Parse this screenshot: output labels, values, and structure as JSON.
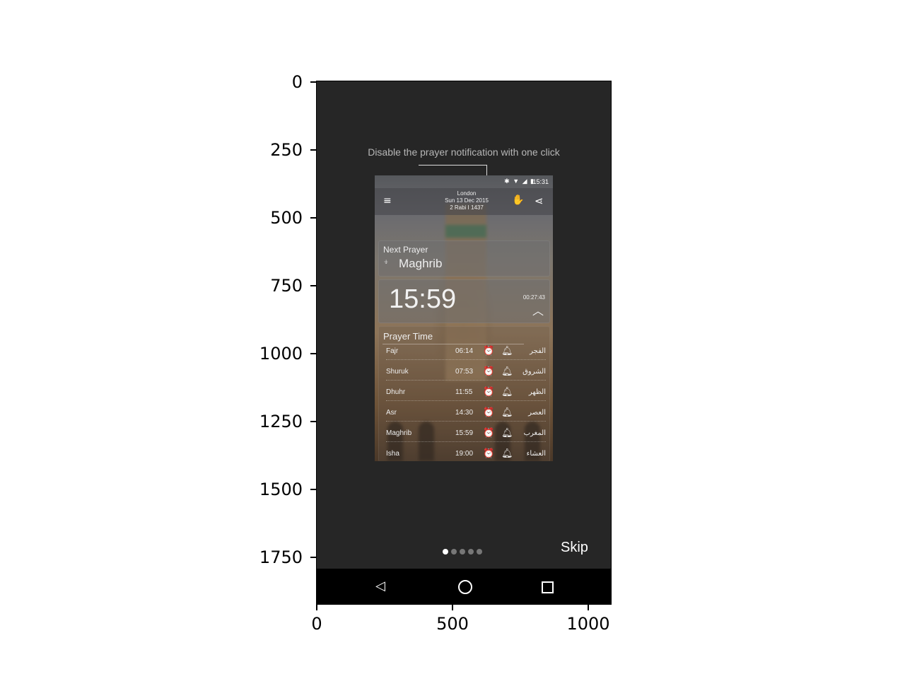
{
  "axes": {
    "y_ticks": [
      "0",
      "250",
      "500",
      "750",
      "1000",
      "1250",
      "1500",
      "1750"
    ],
    "x_ticks": [
      "0",
      "500",
      "1000"
    ]
  },
  "onboarding": {
    "hint": "Disable the prayer notification with one click",
    "skip_label": "Skip",
    "pager": {
      "count": 5,
      "active_index": 0
    }
  },
  "app": {
    "status_time": "15:31",
    "status_icons": "✱ ▼ ◢ ▮",
    "header": {
      "city": "London",
      "date": "Sun 13 Dec 2015",
      "hijri": "2 Rabi I 1437"
    },
    "next_prayer": {
      "label": "Next Prayer",
      "name": "Maghrib"
    },
    "time": {
      "main": "15:59",
      "countdown": "00:27:43"
    },
    "prayer_time": {
      "title": "Prayer Time",
      "rows": [
        {
          "name": "Fajr",
          "time": "06:14",
          "arabic": "الفجر"
        },
        {
          "name": "Shuruk",
          "time": "07:53",
          "arabic": "الشروق"
        },
        {
          "name": "Dhuhr",
          "time": "11:55",
          "arabic": "الظهر"
        },
        {
          "name": "Asr",
          "time": "14:30",
          "arabic": "العصر"
        },
        {
          "name": "Maghrib",
          "time": "15:59",
          "arabic": "المغرب"
        },
        {
          "name": "Isha",
          "time": "19:00",
          "arabic": "العشاء"
        }
      ]
    }
  },
  "icons": {
    "menu": "menu-icon",
    "hand": "hand-icon",
    "share": "share-icon",
    "alarm": "alarm-clock-icon",
    "bell": "bell-icon",
    "chevron": "chevron-up-icon",
    "nav_back": "back-icon",
    "nav_home": "home-icon",
    "nav_recent": "recent-apps-icon"
  }
}
